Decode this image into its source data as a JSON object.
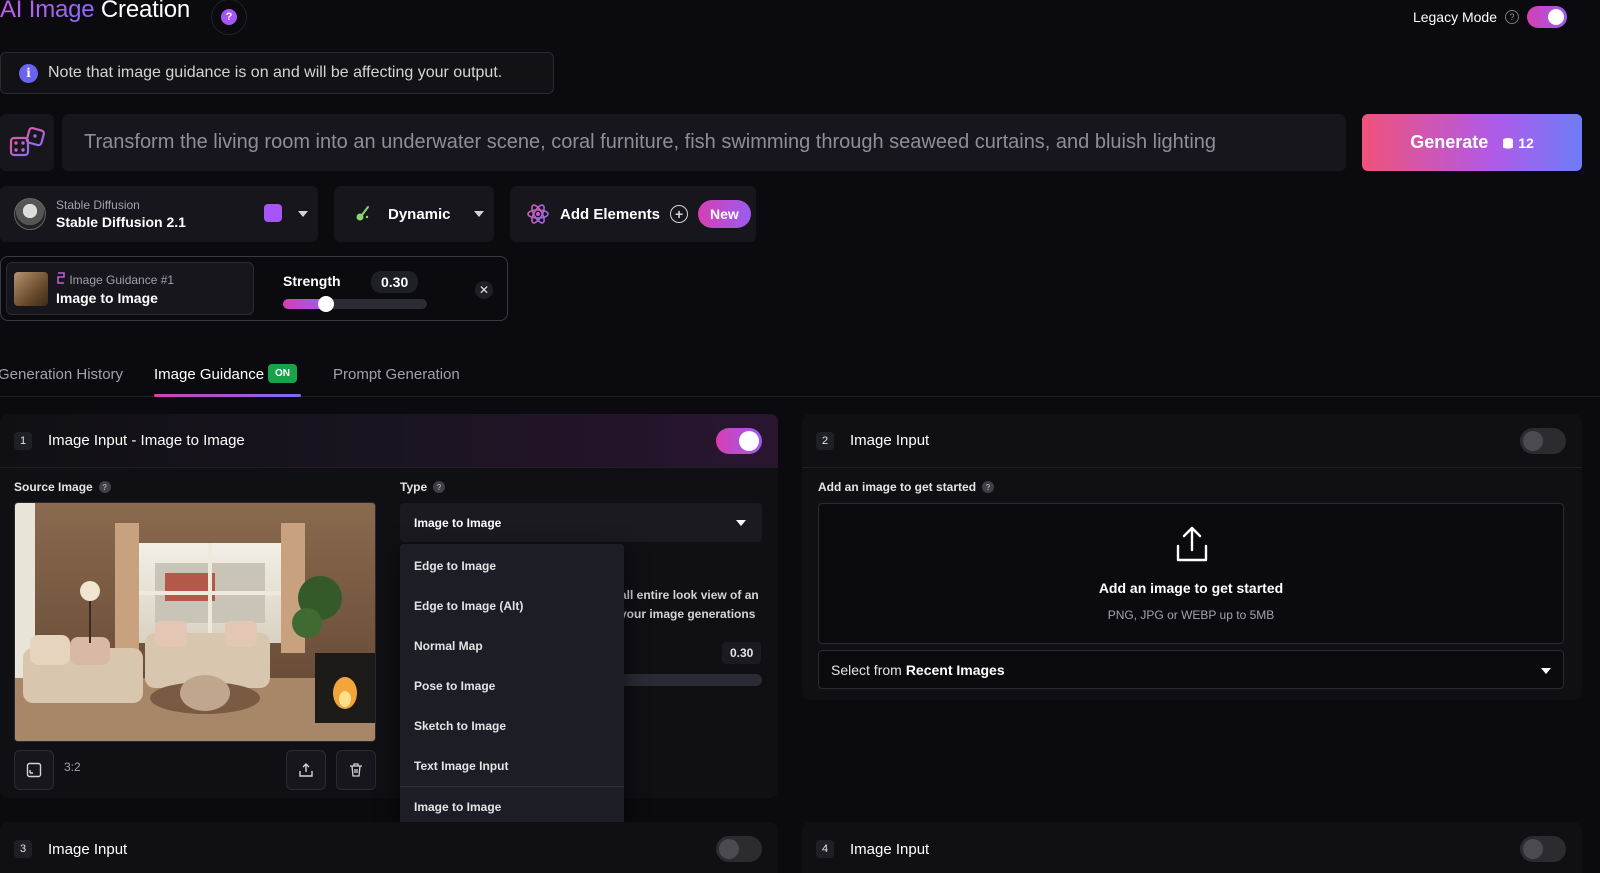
{
  "header": {
    "title_part1": "AI Image",
    "title_part2": "Creation",
    "help_glyph": "?",
    "legacy_label": "Legacy Mode",
    "legacy_help": "?"
  },
  "note": {
    "text": "Note that image guidance is on and will be affecting your output.",
    "icon": "info-icon"
  },
  "prompt": {
    "text": "Transform the living room into an underwater scene, coral furniture, fish swimming through seaweed curtains, and bluish lighting",
    "random_icon": "dice-icon"
  },
  "generate": {
    "label": "Generate",
    "cost": "12",
    "icon": "coins-icon"
  },
  "model": {
    "subtitle": "Stable Diffusion",
    "name": "Stable Diffusion 2.1"
  },
  "style": {
    "label": "Dynamic"
  },
  "elements": {
    "label": "Add Elements",
    "plus": "+",
    "badge": "New"
  },
  "guidance_chip": {
    "subtitle": "Image Guidance #1",
    "name": "Image to Image",
    "strength_label": "Strength",
    "strength_value": "0.30",
    "strength_fraction": 0.3,
    "close": "✕"
  },
  "tabs": [
    {
      "label": "Generation History"
    },
    {
      "label": "Image Guidance",
      "badge": "ON"
    },
    {
      "label": "Prompt Generation"
    }
  ],
  "panels": [
    {
      "number": "1",
      "title": "Image Input - Image to Image",
      "enabled": true
    },
    {
      "number": "2",
      "title": "Image Input",
      "enabled": false
    },
    {
      "number": "3",
      "title": "Image Input",
      "enabled": false
    },
    {
      "number": "4",
      "title": "Image Input",
      "enabled": false
    }
  ],
  "panel1": {
    "source_label": "Source Image",
    "type_label": "Type",
    "type_value": "Image to Image",
    "help": "?",
    "aspect_ratio": "3:2",
    "desc_line1": "all entire look view of an",
    "desc_line2": "your image generations",
    "strength_value": "0.30",
    "type_options": [
      "Edge to Image",
      "Edge to Image (Alt)",
      "Normal Map",
      "Pose to Image",
      "Sketch to Image",
      "Text Image Input",
      "Image to Image"
    ]
  },
  "panel2": {
    "add_label": "Add an image to get started",
    "dz_title": "Add an image to get started",
    "dz_sub": "PNG, JPG or WEBP up to 5MB",
    "recent_prefix": "Select from",
    "recent_bold": "Recent Images"
  },
  "colors": {
    "accent_start": "#d63fb2",
    "accent_end": "#9b5cf0",
    "background": "#0b0b0f",
    "on_badge": "#16a34a"
  }
}
